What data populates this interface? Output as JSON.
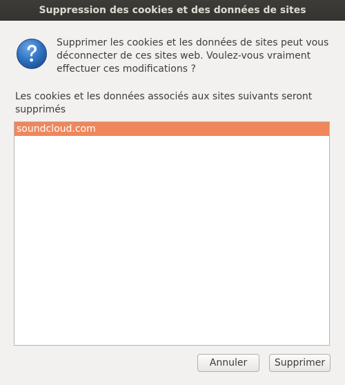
{
  "window": {
    "title": "Suppression des cookies et des données de sites"
  },
  "dialog": {
    "icon": "question-icon",
    "message": "Supprimer les cookies et les données de sites peut vous déconnecter de ces sites web. Voulez-vous vraiment effectuer ces modifications ?",
    "list_caption": "Les cookies et les données associés aux sites suivants seront supprimés",
    "sites": [
      {
        "label": "soundcloud.com",
        "selected": true
      }
    ]
  },
  "buttons": {
    "cancel_label": "Annuler",
    "confirm_label": "Supprimer"
  },
  "colors": {
    "selection": "#f0865c",
    "icon_blue": "#2a6fbe",
    "titlebar": "#3a3935"
  }
}
